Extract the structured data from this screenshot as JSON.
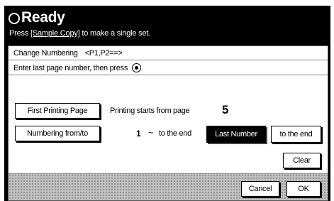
{
  "header": {
    "status": "Ready",
    "instruction_prefix": "Press ",
    "instruction_key": "[Sample Copy]",
    "instruction_suffix": " to make a single set."
  },
  "dialog": {
    "title": "Change Numbering",
    "title_range": "<P1,P2==>",
    "prompt": "Enter last page number, then press"
  },
  "first_page": {
    "button_label": "First Printing Page",
    "description": "Printing starts from page",
    "value": "5"
  },
  "numbering": {
    "button_label": "Numbering from/to",
    "start_value": "1",
    "tilde": "~",
    "end_text": "to the end",
    "last_number_label": "Last Number",
    "to_end_label": "to the end"
  },
  "actions": {
    "clear_label": "Clear",
    "cancel_label": "Cancel",
    "ok_label": "OK"
  }
}
